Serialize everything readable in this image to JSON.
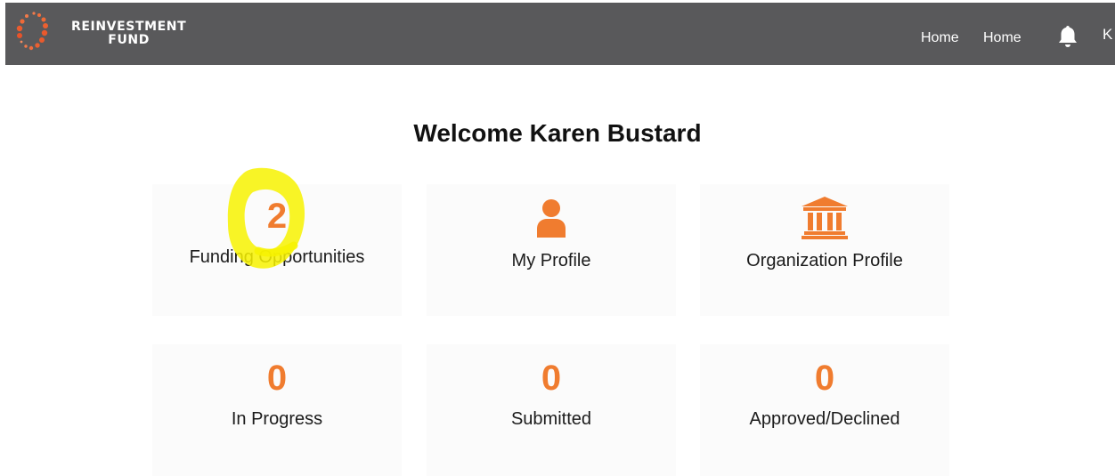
{
  "header": {
    "brand_line1": "REINVESTMENT",
    "brand_line2": "FUND",
    "nav": [
      {
        "label": "Home"
      },
      {
        "label": "Home"
      }
    ],
    "bell_icon": "bell-icon",
    "user_initial": "K",
    "bar_color": "#59595b"
  },
  "welcome": "Welcome Karen Bustard",
  "accent_color": "#f07c2f",
  "cards": {
    "funding": {
      "value": "2",
      "label": "Funding Opportunities"
    },
    "profile": {
      "icon": "person-icon",
      "label": "My Profile"
    },
    "organization": {
      "icon": "bank-building-icon",
      "label": "Organization Profile"
    },
    "in_progress": {
      "value": "0",
      "label": "In Progress"
    },
    "submitted": {
      "value": "0",
      "label": "Submitted"
    },
    "approved": {
      "value": "0",
      "label": "Approved/Declined"
    }
  },
  "annotation": {
    "type": "yellow-highlighter-circle",
    "color": "#f7f200"
  }
}
